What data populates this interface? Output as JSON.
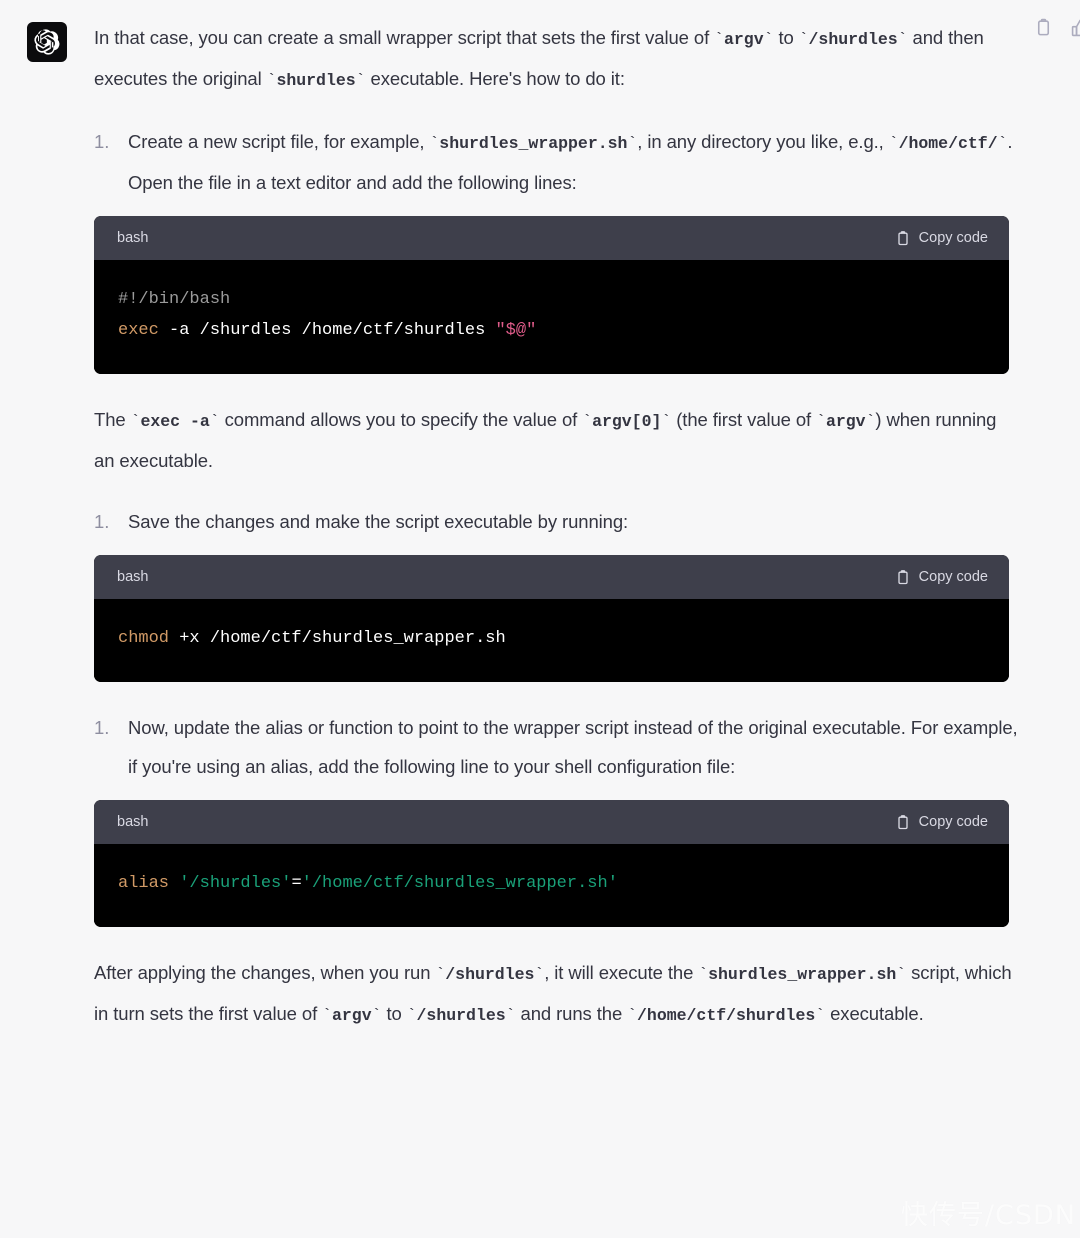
{
  "message": {
    "avatar_icon": "openai-logo-icon",
    "action_icons": [
      "clipboard-copy-icon",
      "thumbs-up-icon"
    ]
  },
  "blocks": [
    {
      "kind": "paragraph",
      "name": "intro-paragraph",
      "runs": [
        {
          "t": "text",
          "v": "In that case, you can create a small wrapper script that sets the first value of "
        },
        {
          "t": "code",
          "v": "argv"
        },
        {
          "t": "text",
          "v": " to "
        },
        {
          "t": "code",
          "v": "/shurdles"
        },
        {
          "t": "text",
          "v": " and then executes the original "
        },
        {
          "t": "code",
          "v": "shurdles"
        },
        {
          "t": "text",
          "v": " executable. Here's how to do it:"
        }
      ]
    },
    {
      "kind": "ordered-list",
      "name": "step-1-list",
      "items": [
        {
          "marker": "1.",
          "runs": [
            {
              "t": "text",
              "v": "Create a new script file, for example, "
            },
            {
              "t": "code",
              "v": "shurdles_wrapper.sh"
            },
            {
              "t": "text",
              "v": ", in any directory you like, e.g., "
            },
            {
              "t": "code",
              "v": "/home/ctf/"
            },
            {
              "t": "text",
              "v": ". Open the file in a text editor and add the following lines:"
            }
          ]
        }
      ]
    },
    {
      "kind": "code",
      "name": "code-block-wrapper-script",
      "language": "bash",
      "copy_label": "Copy code",
      "copy_icon": "clipboard-icon",
      "lines": [
        [
          {
            "cls": "tok-comment",
            "v": "#!/bin/bash"
          }
        ],
        [
          {
            "cls": "tok-kw",
            "v": "exec"
          },
          {
            "cls": "tok-plain",
            "v": " -a /shurdles /home/ctf/shurdles "
          },
          {
            "cls": "tok-str-pink",
            "v": "\"$@\""
          }
        ]
      ],
      "plain_text": "#!/bin/bash\nexec -a /shurdles /home/ctf/shurdles \"$@\""
    },
    {
      "kind": "paragraph",
      "name": "exec-explanation-paragraph",
      "runs": [
        {
          "t": "text",
          "v": "The "
        },
        {
          "t": "code",
          "v": "exec -a"
        },
        {
          "t": "text",
          "v": " command allows you to specify the value of "
        },
        {
          "t": "code",
          "v": "argv[0]"
        },
        {
          "t": "text",
          "v": " (the first value of "
        },
        {
          "t": "code",
          "v": "argv"
        },
        {
          "t": "text",
          "v": ") when running an executable."
        }
      ]
    },
    {
      "kind": "ordered-list",
      "name": "step-2-list",
      "items": [
        {
          "marker": "1.",
          "runs": [
            {
              "t": "text",
              "v": "Save the changes and make the script executable by running:"
            }
          ]
        }
      ]
    },
    {
      "kind": "code",
      "name": "code-block-chmod",
      "language": "bash",
      "copy_label": "Copy code",
      "copy_icon": "clipboard-icon",
      "lines": [
        [
          {
            "cls": "tok-kw",
            "v": "chmod"
          },
          {
            "cls": "tok-plain",
            "v": " +x /home/ctf/shurdles_wrapper.sh"
          }
        ]
      ],
      "plain_text": "chmod +x /home/ctf/shurdles_wrapper.sh"
    },
    {
      "kind": "ordered-list",
      "name": "step-3-list",
      "items": [
        {
          "marker": "1.",
          "runs": [
            {
              "t": "text",
              "v": "Now, update the alias or function to point to the wrapper script instead of the original executable. For example, if you're using an alias, add the following line to your shell configuration file:"
            }
          ]
        }
      ]
    },
    {
      "kind": "code",
      "name": "code-block-alias",
      "language": "bash",
      "copy_label": "Copy code",
      "copy_icon": "clipboard-icon",
      "lines": [
        [
          {
            "cls": "tok-kw",
            "v": "alias"
          },
          {
            "cls": "tok-plain",
            "v": " "
          },
          {
            "cls": "tok-str-grn",
            "v": "'/shurdles'"
          },
          {
            "cls": "tok-op",
            "v": "="
          },
          {
            "cls": "tok-str-grn",
            "v": "'/home/ctf/shurdles_wrapper.sh'"
          }
        ]
      ],
      "plain_text": "alias '/shurdles'='/home/ctf/shurdles_wrapper.sh'"
    },
    {
      "kind": "paragraph",
      "name": "closing-paragraph",
      "runs": [
        {
          "t": "text",
          "v": "After applying the changes, when you run "
        },
        {
          "t": "code",
          "v": "/shurdles"
        },
        {
          "t": "text",
          "v": ", it will execute the "
        },
        {
          "t": "code",
          "v": "shurdles_wrapper.sh"
        },
        {
          "t": "text",
          "v": " script, which in turn sets the first value of "
        },
        {
          "t": "code",
          "v": "argv"
        },
        {
          "t": "text",
          "v": " to "
        },
        {
          "t": "code",
          "v": "/shurdles"
        },
        {
          "t": "text",
          "v": " and runs the "
        },
        {
          "t": "code",
          "v": "/home/ctf/shurdles"
        },
        {
          "t": "text",
          "v": " executable."
        }
      ]
    }
  ],
  "watermark": "快传号/CSDN",
  "colors": {
    "page_background": "#f7f7f8",
    "text": "#343541",
    "marker": "#8e8ea0",
    "code_header_background": "#3e3f4b",
    "code_body_background": "#000000",
    "code_header_text": "#d9d9e3",
    "keyword": "#d19a66",
    "comment": "#9b9b9b",
    "string_pink": "#e05c8a",
    "string_green": "#1aa179",
    "action_icon": "#acacbe",
    "avatar_background": "#0b0b0d"
  }
}
